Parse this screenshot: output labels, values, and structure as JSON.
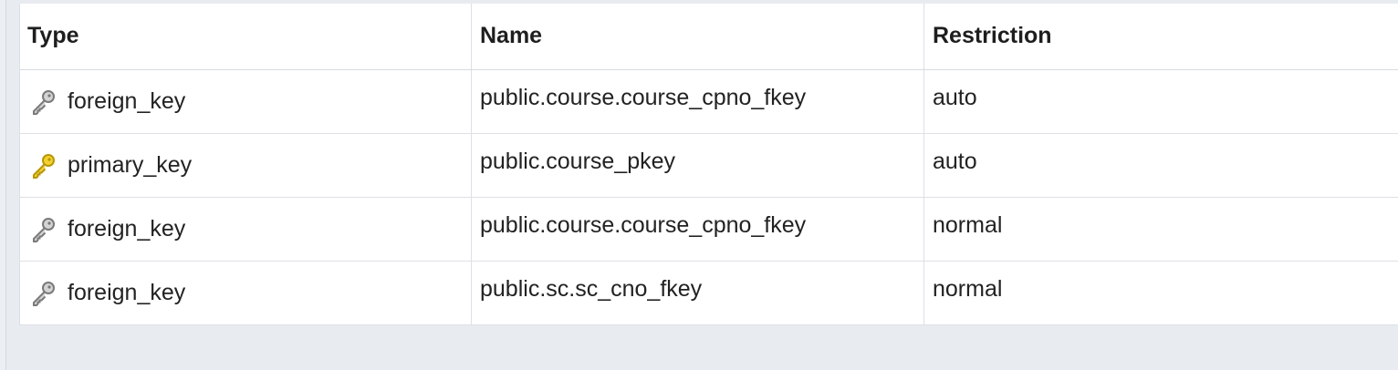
{
  "table": {
    "columns": [
      "Type",
      "Name",
      "Restriction"
    ],
    "rows": [
      {
        "type": "foreign_key",
        "icon": "foreign-key-icon",
        "name": "public.course.course_cpno_fkey",
        "restriction": "auto"
      },
      {
        "type": "primary_key",
        "icon": "primary-key-icon",
        "name": "public.course_pkey",
        "restriction": "auto"
      },
      {
        "type": "foreign_key",
        "icon": "foreign-key-icon",
        "name": "public.course.course_cpno_fkey",
        "restriction": "normal"
      },
      {
        "type": "foreign_key",
        "icon": "foreign-key-icon",
        "name": "public.sc.sc_cno_fkey",
        "restriction": "normal"
      }
    ]
  },
  "colors": {
    "foreign_key_icon": "#8a8a8a",
    "primary_key_icon": "#e8c21a",
    "background": "#e8ebf0"
  }
}
